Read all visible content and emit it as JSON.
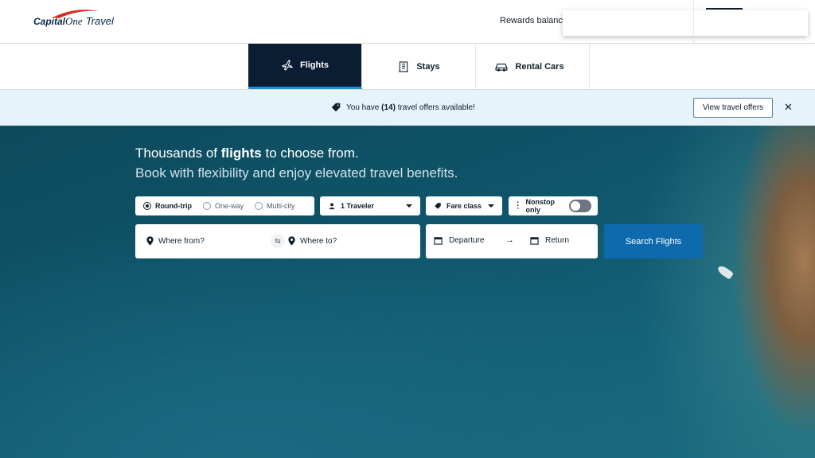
{
  "header": {
    "logo": {
      "capital": "Capital",
      "one": "One",
      "travel": "Travel"
    },
    "rewards_label": "Rewards balance:"
  },
  "tabs": [
    {
      "label": "Flights",
      "icon": "airplane-icon",
      "active": true
    },
    {
      "label": "Stays",
      "icon": "building-icon",
      "active": false
    },
    {
      "label": "Rental Cars",
      "icon": "car-icon",
      "active": false
    }
  ],
  "offer_banner": {
    "prefix": "You have ",
    "count": "(14)",
    "suffix": " travel offers available!",
    "button_label": "View travel offers",
    "close_glyph": "✕"
  },
  "hero": {
    "title_prefix": "Thousands of ",
    "title_bold": "flights",
    "title_suffix": " to choose from.",
    "subtitle": "Book with flexibility and enjoy elevated travel benefits."
  },
  "search": {
    "trip_types": [
      {
        "label": "Round-trip",
        "selected": true
      },
      {
        "label": "One-way",
        "selected": false
      },
      {
        "label": "Multi-city",
        "selected": false
      }
    ],
    "travelers": "1 Traveler",
    "fare_class": "Fare class",
    "nonstop_label": "Nonstop only",
    "nonstop_on": false,
    "where_from": "Where from?",
    "where_to": "Where to?",
    "swap_glyph": "⇆",
    "departure": "Departure",
    "arrow_glyph": "→",
    "return": "Return",
    "submit_label": "Search Flights"
  },
  "colors": {
    "brand_navy": "#0a1d33",
    "accent_blue": "#0f6aad",
    "tab_underline": "#1a8fd6",
    "banner_bg": "#e6f3fa",
    "logo_red": "#d03027"
  }
}
